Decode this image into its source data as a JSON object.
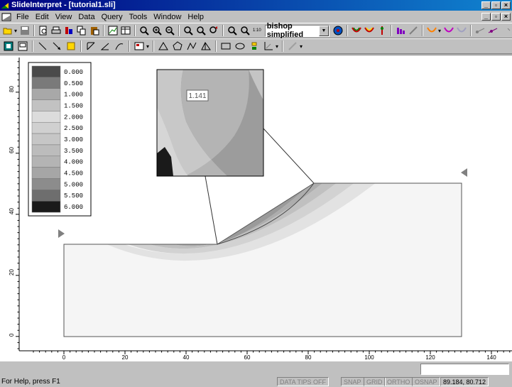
{
  "window": {
    "title": "SlideInterpret - [tutorial1.sli]"
  },
  "menu": {
    "items": [
      "File",
      "Edit",
      "View",
      "Data",
      "Query",
      "Tools",
      "Window",
      "Help"
    ]
  },
  "toolbar": {
    "method_value": "bishop simplified",
    "zoom_scale_label": "1:10"
  },
  "legend": {
    "values": [
      "0.000",
      "0.500",
      "1.000",
      "1.500",
      "2.000",
      "2.500",
      "3.000",
      "3.500",
      "4.000",
      "4.500",
      "5.000",
      "5.500",
      "6.000"
    ],
    "colors": [
      "#4a4a4a",
      "#7a7a7a",
      "#a8a8a8",
      "#c2c2c2",
      "#dcdcdc",
      "#d0d0d0",
      "#c6c6c6",
      "#bcbcbc",
      "#b4b4b4",
      "#a6a6a6",
      "#8c8c8c",
      "#6e6e6e",
      "#1a1a1a"
    ]
  },
  "plot": {
    "fos_label": "1.141",
    "x_ticks": [
      "0",
      "20",
      "40",
      "60",
      "80",
      "100",
      "120",
      "140"
    ],
    "y_ticks": [
      "0",
      "20",
      "40",
      "60",
      "80"
    ]
  },
  "status": {
    "help_text": "For Help, press F1",
    "data_tips": "DATA TIPS OFF",
    "snap": "SNAP",
    "grid": "GRID",
    "ortho": "ORTHO",
    "osnap": "OSNAP",
    "coords": "89.184, 80.712"
  }
}
